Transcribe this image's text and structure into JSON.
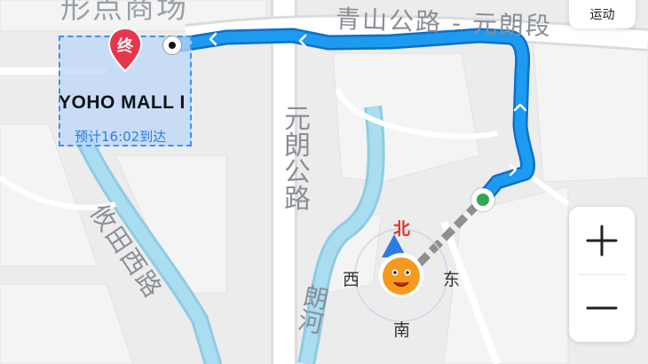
{
  "map": {
    "labels": {
      "mall_partial": "形点商场",
      "road_qingshan": "青山公路 - 元朗段",
      "road_yuenlong": "元朗公路",
      "road_kautin": "攸田西路",
      "road_longhe": "朗河"
    },
    "destination": {
      "pin_label": "终",
      "name": "YOHO MALL I",
      "eta": "预计16:02到达"
    },
    "compass": {
      "north": "北",
      "south": "南",
      "east": "东",
      "west": "西"
    },
    "colors": {
      "route": "#1c9bf0",
      "route_outline": "#0e6fc9",
      "river": "#9fd4ea",
      "pin": "#e8364b",
      "start": "#2fa84f"
    }
  },
  "controls": {
    "mode_label": "运动",
    "zoom_in_icon": "plus-icon",
    "zoom_out_icon": "minus-icon"
  }
}
